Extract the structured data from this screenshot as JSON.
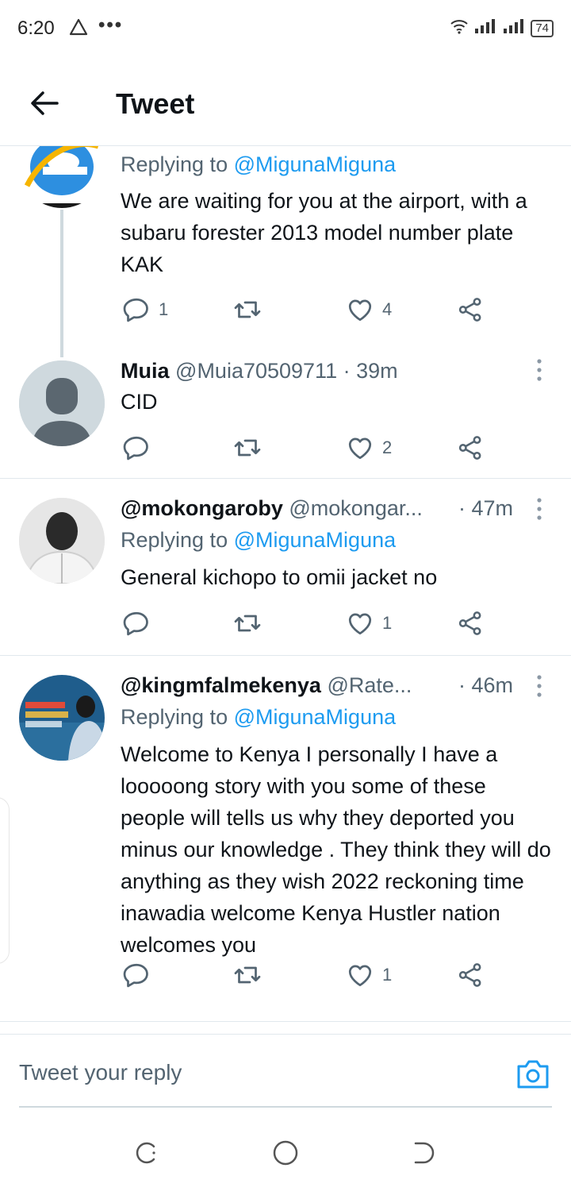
{
  "status_bar": {
    "time": "6:20",
    "battery": "74"
  },
  "header": {
    "title": "Tweet"
  },
  "tweets": [
    {
      "reply_to_prefix": "Replying to ",
      "reply_to": "@MigunaMiguna",
      "text": "We are waiting for you at the airport, with a subaru forester 2013 model number plate KAK",
      "replies": "1",
      "retweets": "",
      "likes": "4"
    },
    {
      "name": "Muia",
      "handle": "@Muia70509711",
      "time": "· 39m",
      "text": "CID",
      "replies": "",
      "retweets": "",
      "likes": "2"
    },
    {
      "name": "@mokongaroby",
      "handle": "@mokongar...",
      "time": "· 47m",
      "reply_to_prefix": "Replying to ",
      "reply_to": "@MigunaMiguna",
      "text": "General kichopo to omii jacket no",
      "replies": "",
      "retweets": "",
      "likes": "1"
    },
    {
      "name": "@kingmfalmekenya",
      "handle": "@Rate...",
      "time": "· 46m",
      "reply_to_prefix": "Replying to ",
      "reply_to": "@MigunaMiguna",
      "text": "Welcome to Kenya I personally I have a looooong story with you some of these people will tells us why they deported you minus our knowledge . They think they will do anything as they wish 2022 reckoning time  inawadia welcome Kenya Hustler nation welcomes you",
      "replies": "",
      "retweets": "",
      "likes": "1"
    }
  ],
  "reply_bar": {
    "placeholder": "Tweet your reply"
  },
  "colors": {
    "accent": "#1d9bf0",
    "text": "#0f1419",
    "muted": "#536471",
    "divider": "#e1e8ed"
  },
  "icons": [
    "back-arrow-icon",
    "reply-icon",
    "retweet-icon",
    "like-icon",
    "share-icon",
    "more-icon",
    "camera-icon",
    "recents-icon",
    "home-icon",
    "back-icon"
  ]
}
